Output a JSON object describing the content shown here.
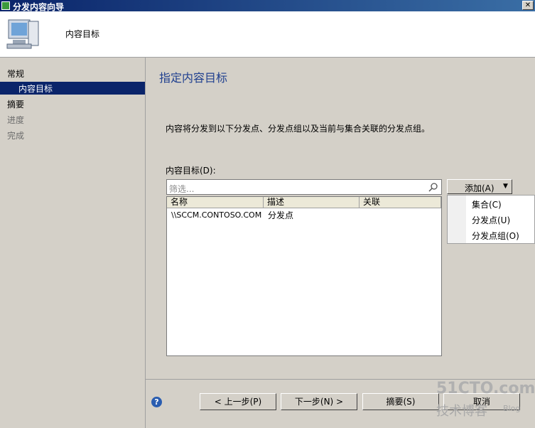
{
  "window": {
    "title": "分发内容向导",
    "close_glyph": "✕"
  },
  "header": {
    "title": "内容目标",
    "icon": "computer-icon"
  },
  "nav": {
    "group1": "常规",
    "active_sub": "内容目标",
    "summary": "摘要",
    "progress": "进度",
    "complete": "完成"
  },
  "main": {
    "title": "指定内容目标",
    "description": "内容将分发到以下分发点、分发点组以及当前与集合关联的分发点组。",
    "list_label": "内容目标(D):",
    "filter_placeholder": "筛选...",
    "columns": [
      "名称",
      "描述",
      "关联"
    ],
    "rows": [
      {
        "name": "\\\\SCCM.CONTOSO.COM",
        "desc": "分发点",
        "assoc": ""
      }
    ],
    "add_button": "添加(A)",
    "add_menu": [
      "集合(C)",
      "分发点(U)",
      "分发点组(O)"
    ]
  },
  "footer": {
    "help": "?",
    "prev": "< 上一步(P)",
    "next": "下一步(N) >",
    "summary": "摘要(S)",
    "cancel": "取消"
  },
  "watermark": {
    "line1": "51CTO.com",
    "line2": "技术博客",
    "line3": "Blog"
  }
}
